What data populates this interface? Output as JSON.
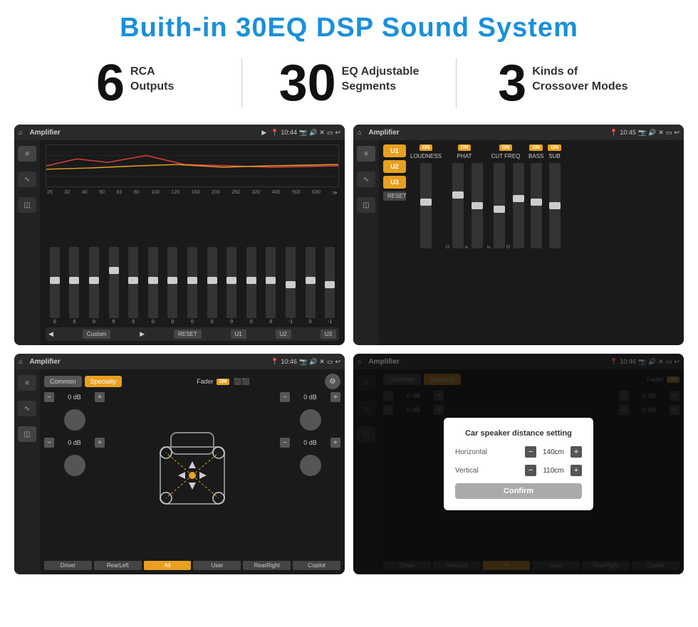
{
  "page": {
    "title": "Buith-in 30EQ DSP Sound System"
  },
  "stats": [
    {
      "number": "6",
      "text": "RCA\nOutputs"
    },
    {
      "number": "30",
      "text": "EQ Adjustable\nSegments"
    },
    {
      "number": "3",
      "text": "Kinds of\nCrossover Modes"
    }
  ],
  "screens": [
    {
      "id": "eq-screen",
      "topbar": {
        "title": "Amplifier",
        "time": "10:44"
      },
      "type": "equalizer"
    },
    {
      "id": "amp-screen",
      "topbar": {
        "title": "Amplifier",
        "time": "10:45"
      },
      "type": "amplifier"
    },
    {
      "id": "speaker-screen",
      "topbar": {
        "title": "Amplifier",
        "time": "10:46"
      },
      "type": "speaker"
    },
    {
      "id": "modal-screen",
      "topbar": {
        "title": "Amplifier",
        "time": "10:46"
      },
      "type": "modal"
    }
  ],
  "eq": {
    "frequencies": [
      "25",
      "32",
      "40",
      "50",
      "63",
      "80",
      "100",
      "125",
      "160",
      "200",
      "250",
      "320",
      "400",
      "500",
      "630"
    ],
    "values": [
      "0",
      "0",
      "0",
      "5",
      "0",
      "0",
      "0",
      "0",
      "0",
      "0",
      "0",
      "0",
      "-1",
      "0",
      "-1"
    ],
    "preset": "Custom",
    "buttons": [
      "RESET",
      "U1",
      "U2",
      "U3"
    ]
  },
  "amplifier": {
    "presets": [
      "U1",
      "U2",
      "U3"
    ],
    "channels": [
      "LOUDNESS",
      "PHAT",
      "CUT FREQ",
      "BASS",
      "SUB"
    ],
    "reset_label": "RESET"
  },
  "speaker": {
    "buttons": [
      "Common",
      "Specialty"
    ],
    "fader_label": "Fader",
    "fader_on": "ON",
    "db_values": [
      "0 dB",
      "0 dB",
      "0 dB",
      "0 dB"
    ],
    "bottom_buttons": [
      "Driver",
      "RearLeft",
      "All",
      "User",
      "RearRight",
      "Copilot"
    ]
  },
  "modal": {
    "title": "Car speaker distance setting",
    "horizontal_label": "Horizontal",
    "horizontal_value": "140cm",
    "vertical_label": "Vertical",
    "vertical_value": "110cm",
    "confirm_label": "Confirm",
    "db_values": [
      "0 dB",
      "0 dB"
    ]
  }
}
